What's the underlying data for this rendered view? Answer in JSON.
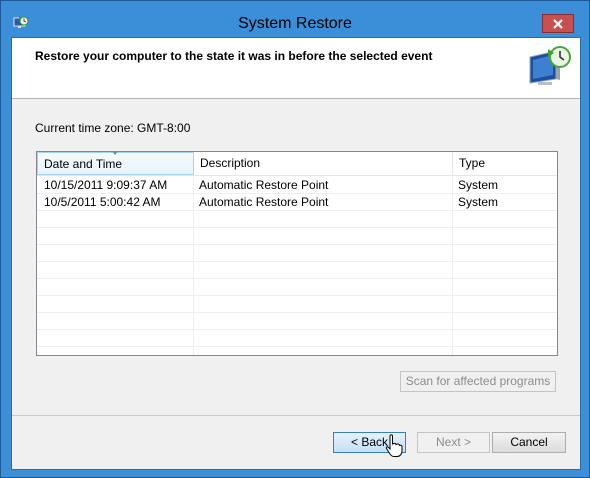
{
  "window": {
    "title": "System Restore",
    "close_icon": "close-icon",
    "app_icon": "system-restore-icon"
  },
  "header": {
    "title": "Restore your computer to the state it was in before the selected event",
    "icon": "restore-monitor-icon"
  },
  "timezone": {
    "label": "Current time zone: GMT-8:00"
  },
  "restore_list": {
    "columns": [
      "Date and Time",
      "Description",
      "Type"
    ],
    "sorted_column": "Date and Time",
    "rows": [
      {
        "date": "10/15/2011 9:09:37 AM",
        "description": "Automatic Restore Point",
        "type": "System"
      },
      {
        "date": "10/5/2011 5:00:42 AM",
        "description": "Automatic Restore Point",
        "type": "System"
      }
    ]
  },
  "buttons": {
    "scan": "Scan for affected programs",
    "back": "< Back",
    "next": "Next >",
    "cancel": "Cancel"
  },
  "colors": {
    "title_bar": "#3b8ed8",
    "close_button": "#c75050",
    "client_background": "#f0f0f0"
  }
}
